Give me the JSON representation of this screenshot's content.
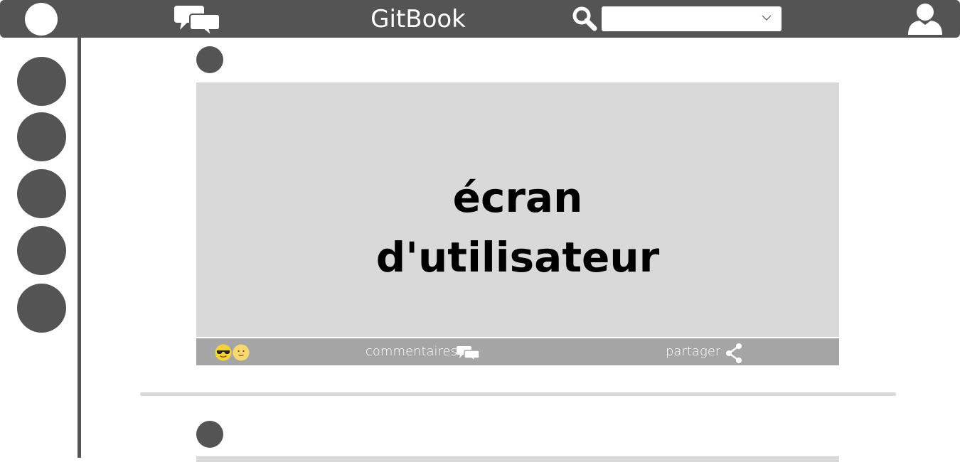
{
  "header": {
    "app_title": "GitBook",
    "search": {
      "value": "",
      "placeholder": ""
    }
  },
  "feed": {
    "post": {
      "media_line1": "écran",
      "media_line2": "d'utilisateur",
      "reactions": [
        "cool-emoji",
        "smile-emoji"
      ],
      "comments_label": "commentaires",
      "share_label": "partager"
    }
  },
  "colors": {
    "bar": "#545454",
    "media": "#d9d9d9",
    "actions": "#a5a5a5"
  }
}
